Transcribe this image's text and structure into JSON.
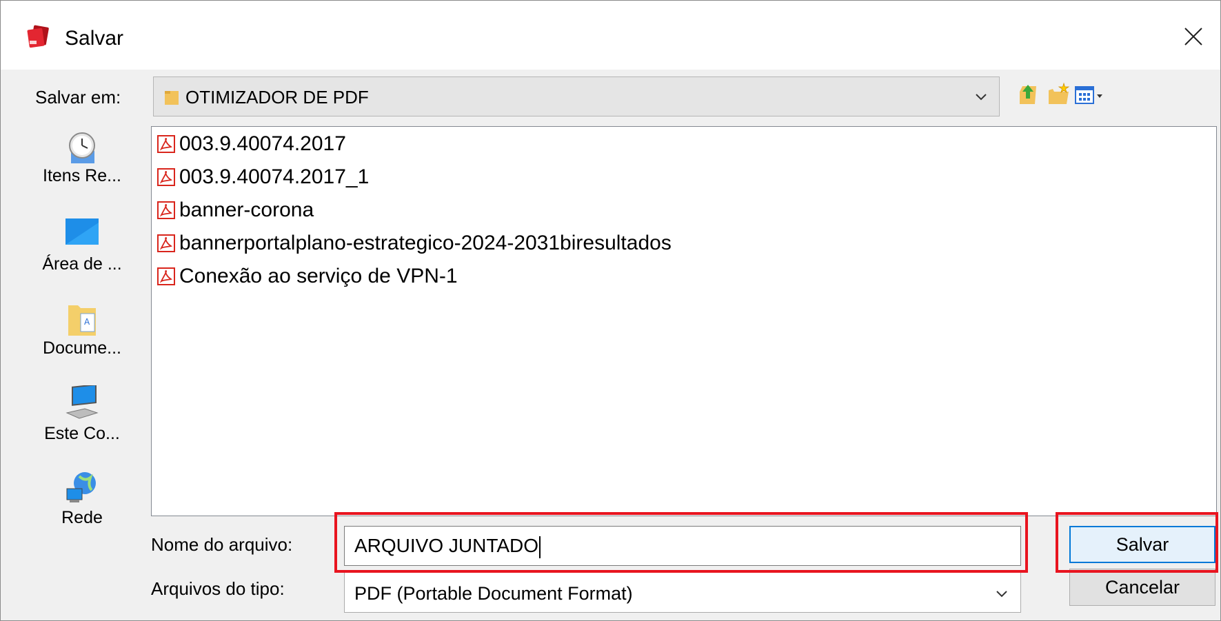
{
  "window": {
    "title": "Salvar"
  },
  "toolbar": {
    "save_in_label": "Salvar em:",
    "current_folder": "OTIMIZADOR DE PDF"
  },
  "places": [
    {
      "label": "Itens Re...",
      "icon": "recent-items-icon"
    },
    {
      "label": "Área de ...",
      "icon": "desktop-icon"
    },
    {
      "label": "Docume...",
      "icon": "documents-icon"
    },
    {
      "label": "Este Co...",
      "icon": "computer-icon"
    },
    {
      "label": "Rede",
      "icon": "network-icon"
    }
  ],
  "files": [
    {
      "name": "003.9.40074.2017",
      "icon": "pdf-icon"
    },
    {
      "name": "003.9.40074.2017_1",
      "icon": "pdf-icon"
    },
    {
      "name": "banner-corona",
      "icon": "pdf-icon"
    },
    {
      "name": "bannerportalplano-estrategico-2024-2031biresultados",
      "icon": "pdf-icon"
    },
    {
      "name": "Conexão ao serviço de VPN-1",
      "icon": "pdf-icon"
    }
  ],
  "form": {
    "filename_label": "Nome do arquivo:",
    "filename_value": "ARQUIVO JUNTADO",
    "filetype_label": "Arquivos do tipo:",
    "filetype_value": "PDF (Portable Document Format)"
  },
  "buttons": {
    "save": "Salvar",
    "cancel": "Cancelar"
  },
  "colors": {
    "highlight": "#e8141f",
    "accent": "#0078d7",
    "pdf_red": "#d9251c"
  }
}
